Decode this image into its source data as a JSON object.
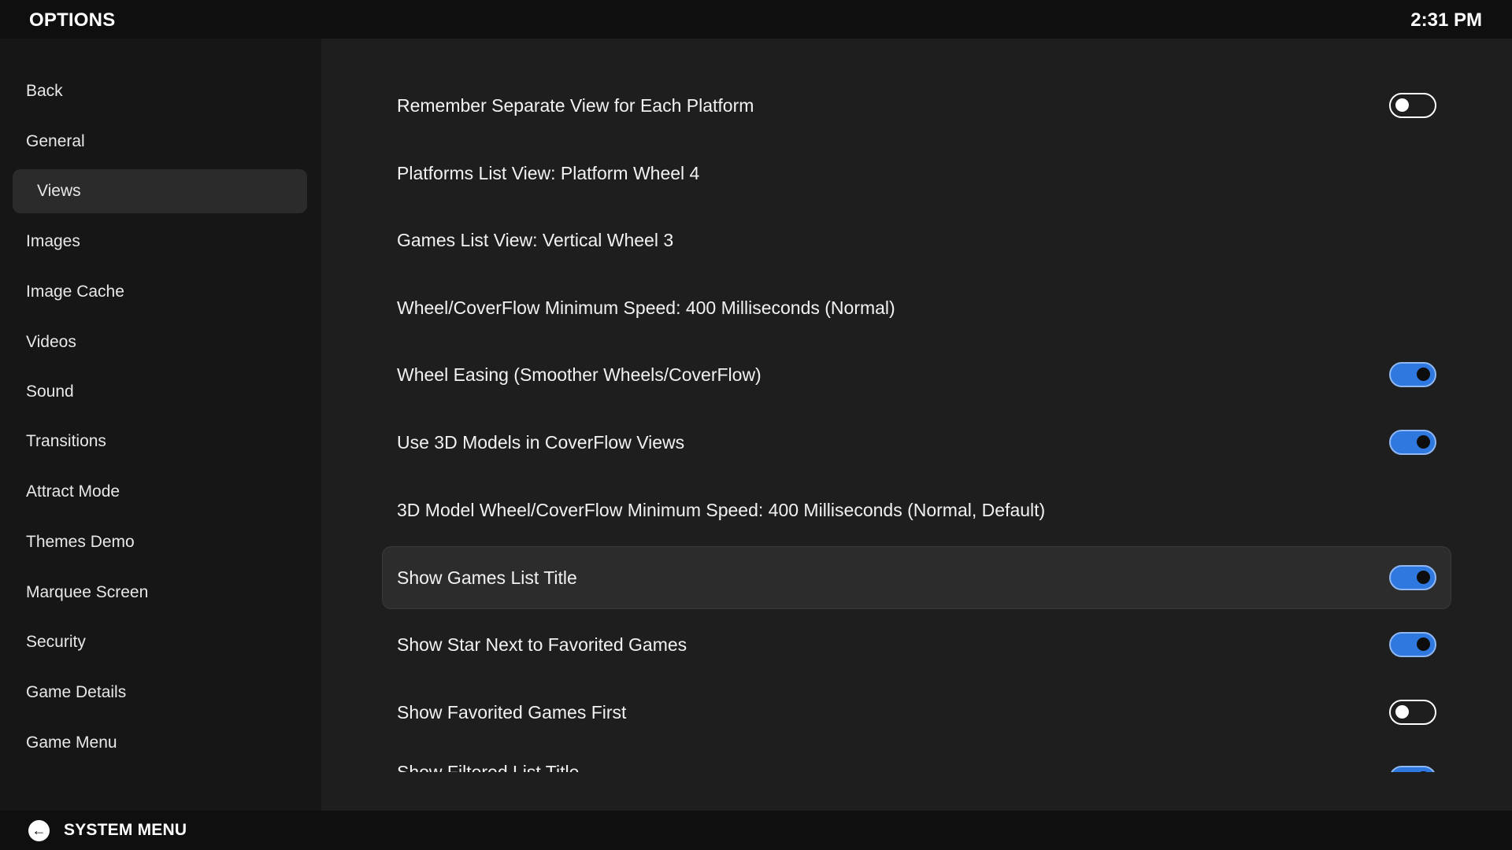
{
  "header": {
    "title": "OPTIONS",
    "clock": "2:31 PM"
  },
  "sidebar": {
    "selected": "Views",
    "items": [
      {
        "label": "Back"
      },
      {
        "label": "General"
      },
      {
        "label": "Views"
      },
      {
        "label": "Images"
      },
      {
        "label": "Image Cache"
      },
      {
        "label": "Videos"
      },
      {
        "label": "Sound"
      },
      {
        "label": "Transitions"
      },
      {
        "label": "Attract Mode"
      },
      {
        "label": "Themes Demo"
      },
      {
        "label": "Marquee Screen"
      },
      {
        "label": "Security"
      },
      {
        "label": "Game Details"
      },
      {
        "label": "Game Menu"
      }
    ]
  },
  "settings": {
    "selected": "Show Games List Title",
    "rows": [
      {
        "label": "Remember Separate View for Each Platform",
        "toggle": "off"
      },
      {
        "label": "Platforms List View: Platform Wheel 4"
      },
      {
        "label": "Games List View: Vertical Wheel 3"
      },
      {
        "label": "Wheel/CoverFlow Minimum Speed: 400 Milliseconds (Normal)"
      },
      {
        "label": "Wheel Easing (Smoother Wheels/CoverFlow)",
        "toggle": "on"
      },
      {
        "label": "Use 3D Models in CoverFlow Views",
        "toggle": "on"
      },
      {
        "label": "3D Model Wheel/CoverFlow Minimum Speed: 400 Milliseconds (Normal, Default)"
      },
      {
        "label": "Show Games List Title",
        "toggle": "on"
      },
      {
        "label": "Show Star Next to Favorited Games",
        "toggle": "on"
      },
      {
        "label": "Show Favorited Games First",
        "toggle": "off"
      }
    ],
    "partial_row": {
      "label": "Show Filtered List Title",
      "toggle": "on"
    }
  },
  "footer": {
    "icon": "back-arrow-icon",
    "label": "SYSTEM MENU"
  },
  "colors": {
    "toggle_on": "#2f78e0",
    "background": "#1e1e1e",
    "sidebar": "#161616",
    "bars": "#0f0f0f"
  }
}
